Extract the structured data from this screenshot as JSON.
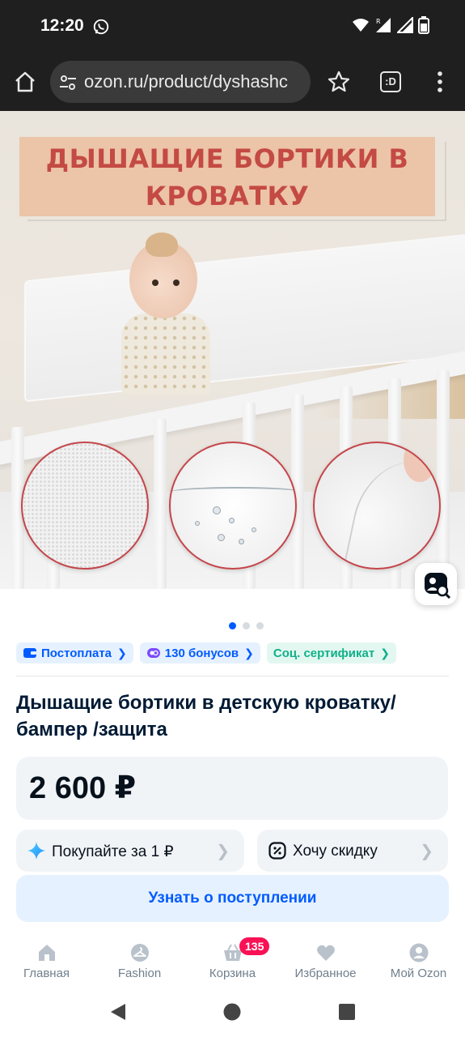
{
  "status_bar": {
    "time": "12:20"
  },
  "browser": {
    "url": "ozon.ru/product/dyshashc",
    "tabs_label": ":D"
  },
  "product_image": {
    "banner_line1": "ДЫШАЩИЕ БОРТИКИ В",
    "banner_line2": "КРОВАТКУ",
    "pager": {
      "count": 3,
      "active": 1
    }
  },
  "chips": [
    {
      "label": "Постоплата",
      "color": "#005bff"
    },
    {
      "label": "130 бонусов",
      "color": "#005bff"
    },
    {
      "label": "Соц. сертификат",
      "color": "#10b089"
    }
  ],
  "product": {
    "title": "Дышащие бортики в детскую кроватку/ бампер /защита",
    "price": "2 600 ₽"
  },
  "promos": {
    "buy_for": "Покупайте за 1 ₽",
    "want_discount": "Хочу скидку"
  },
  "notify_button": "Узнать о поступлении",
  "bottom_nav": [
    {
      "label": "Главная",
      "icon": "home-icon"
    },
    {
      "label": "Fashion",
      "icon": "hanger-icon"
    },
    {
      "label": "Корзина",
      "icon": "basket-icon",
      "badge": "135"
    },
    {
      "label": "Избранное",
      "icon": "heart-icon"
    },
    {
      "label": "Мой Ozon",
      "icon": "profile-icon"
    }
  ],
  "colors": {
    "accent": "#005bff",
    "badge": "#f91155",
    "banner_text": "#c44a44"
  }
}
